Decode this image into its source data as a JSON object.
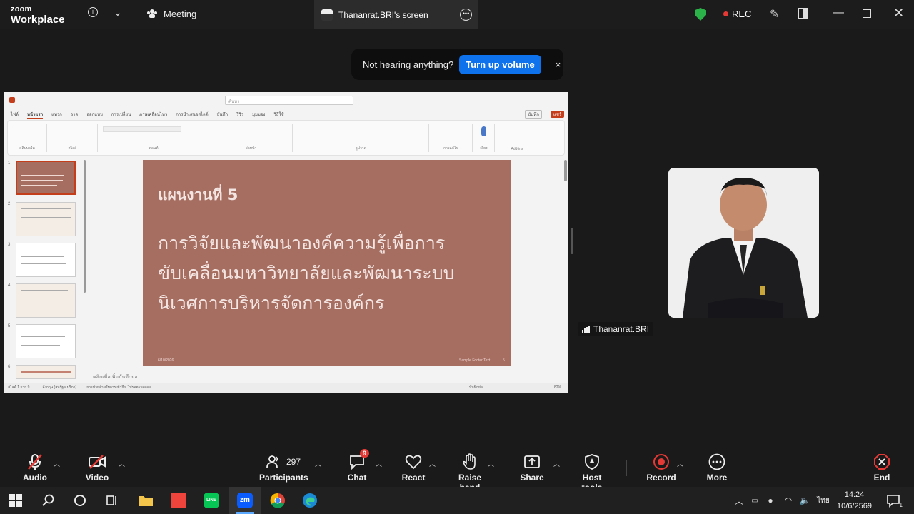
{
  "titlebar": {
    "brand_small": "zoom",
    "brand_big": "Workplace",
    "meeting_label": "Meeting",
    "screen_tab_label": "Thananrat.BRI's screen",
    "rec_label": "REC"
  },
  "notification": {
    "message": "Not hearing anything?",
    "button": "Turn up volume",
    "close": "×"
  },
  "ppt": {
    "menu": [
      "ไฟล์",
      "หน้าแรก",
      "แทรก",
      "วาด",
      "ออกแบบ",
      "การเปลี่ยน",
      "ภาพเคลื่อนไหว",
      "การนำเสนอสไลด์",
      "บันทึก",
      "รีวิว",
      "มุมมอง",
      "วิธีใช้"
    ],
    "ribbon_groups": [
      "คลิปบอร์ด",
      "สไลด์",
      "ฟอนต์",
      "ย่อหน้า",
      "รูปวาด",
      "การแก้ไข",
      "เสียง",
      "Add-ins"
    ],
    "search_placeholder": "ค้นหา",
    "record_btn": "บันทึก",
    "share_btn": "แชร์",
    "thumb_numbers": [
      "1",
      "2",
      "3",
      "4",
      "5",
      "6"
    ],
    "slide": {
      "title": "แผนงานที่ 5",
      "body": [
        "การวิจัยและพัฒนาองค์ความรู้เพื่อการ",
        "ขับเคลื่อนมหาวิทยาลัยและพัฒนาระบบ",
        "นิเวศการบริหารจัดการองค์กร"
      ],
      "footer_date": "6/10/2026",
      "footer_text": "Sample Footer Text",
      "footer_num": "5"
    },
    "notes_placeholder": "คลิกเพื่อเพิ่มบันทึกย่อ",
    "status": {
      "slide_count": "สไลด์ 1 จาก 9",
      "language": "อังกฤษ (สหรัฐอเมริกา)",
      "accessibility": "การช่วยสำหรับการเข้าถึง: โปรดตรวจสอบ",
      "notes": "บันทึกย่อ",
      "zoom": "82%"
    }
  },
  "participant": {
    "name": "Thananrat.BRI"
  },
  "toolbar": {
    "audio": "Audio",
    "video": "Video",
    "participants": "Participants",
    "participant_count": "297",
    "chat": "Chat",
    "chat_badge": "9",
    "react": "React",
    "raise_hand": "Raise hand",
    "share": "Share",
    "host_tools": "Host tools",
    "record": "Record",
    "more": "More",
    "end": "End"
  },
  "taskbar": {
    "time": "14:24",
    "date": "10/6/2569",
    "lang": "ไทย",
    "notif_count": "1"
  },
  "colors": {
    "zoom_blue": "#0e72ed",
    "rec_red": "#e53935",
    "slide_bg": "#a66d61",
    "shield_green": "#2bb34a"
  }
}
